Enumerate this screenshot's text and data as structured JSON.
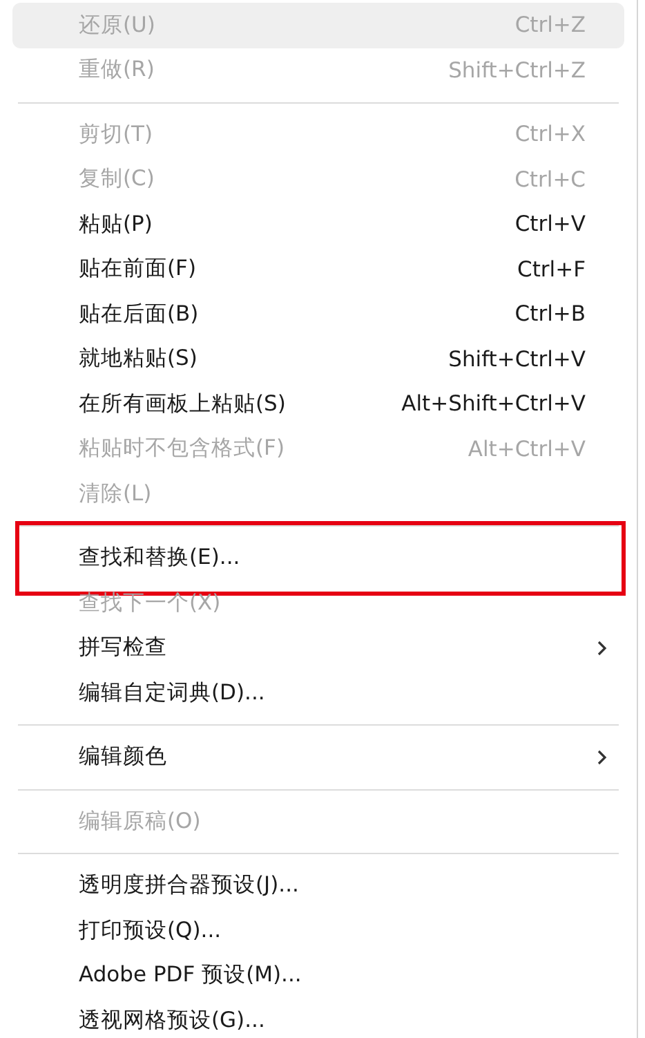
{
  "menu": {
    "groups": [
      {
        "items": [
          {
            "label": "还原(U)",
            "shortcut": "Ctrl+Z",
            "disabled": true,
            "hovered": true,
            "framed": false,
            "submenu": false
          },
          {
            "label": "重做(R)",
            "shortcut": "Shift+Ctrl+Z",
            "disabled": true,
            "hovered": false,
            "framed": false,
            "submenu": false
          }
        ]
      },
      {
        "items": [
          {
            "label": "剪切(T)",
            "shortcut": "Ctrl+X",
            "disabled": true,
            "hovered": false,
            "framed": false,
            "submenu": false
          },
          {
            "label": "复制(C)",
            "shortcut": "Ctrl+C",
            "disabled": true,
            "hovered": false,
            "framed": false,
            "submenu": false
          },
          {
            "label": "粘贴(P)",
            "shortcut": "Ctrl+V",
            "disabled": false,
            "hovered": false,
            "framed": false,
            "submenu": false
          },
          {
            "label": "贴在前面(F)",
            "shortcut": "Ctrl+F",
            "disabled": false,
            "hovered": false,
            "framed": false,
            "submenu": false
          },
          {
            "label": "贴在后面(B)",
            "shortcut": "Ctrl+B",
            "disabled": false,
            "hovered": false,
            "framed": false,
            "submenu": false
          },
          {
            "label": "就地粘贴(S)",
            "shortcut": "Shift+Ctrl+V",
            "disabled": false,
            "hovered": false,
            "framed": false,
            "submenu": false
          },
          {
            "label": "在所有画板上粘贴(S)",
            "shortcut": "Alt+Shift+Ctrl+V",
            "disabled": false,
            "hovered": false,
            "framed": false,
            "submenu": false
          },
          {
            "label": "粘贴时不包含格式(F)",
            "shortcut": "Alt+Ctrl+V",
            "disabled": true,
            "hovered": false,
            "framed": false,
            "submenu": false
          },
          {
            "label": "清除(L)",
            "disabled": true,
            "hovered": false,
            "framed": false,
            "submenu": false
          }
        ]
      },
      {
        "items": [
          {
            "label": "查找和替换(E)...",
            "disabled": false,
            "hovered": false,
            "framed": true,
            "submenu": false
          },
          {
            "label": "查找下一个(X)",
            "disabled": true,
            "hovered": false,
            "framed": false,
            "submenu": false
          },
          {
            "label": "拼写检查",
            "disabled": false,
            "hovered": false,
            "framed": false,
            "submenu": true
          },
          {
            "label": "编辑自定词典(D)...",
            "disabled": false,
            "hovered": false,
            "framed": false,
            "submenu": false
          }
        ]
      },
      {
        "items": [
          {
            "label": "编辑颜色",
            "disabled": false,
            "hovered": false,
            "framed": false,
            "submenu": true
          }
        ]
      },
      {
        "items": [
          {
            "label": "编辑原稿(O)",
            "disabled": true,
            "hovered": false,
            "framed": false,
            "submenu": false
          }
        ]
      },
      {
        "items": [
          {
            "label": "透明度拼合器预设(J)...",
            "disabled": false,
            "hovered": false,
            "framed": false,
            "submenu": false
          },
          {
            "label": "打印预设(Q)...",
            "disabled": false,
            "hovered": false,
            "framed": false,
            "submenu": false
          },
          {
            "label": "Adobe PDF 预设(M)...",
            "disabled": false,
            "hovered": false,
            "framed": false,
            "submenu": false
          },
          {
            "label": "透视网格预设(G)...",
            "disabled": false,
            "hovered": false,
            "framed": false,
            "submenu": false
          }
        ]
      }
    ]
  }
}
